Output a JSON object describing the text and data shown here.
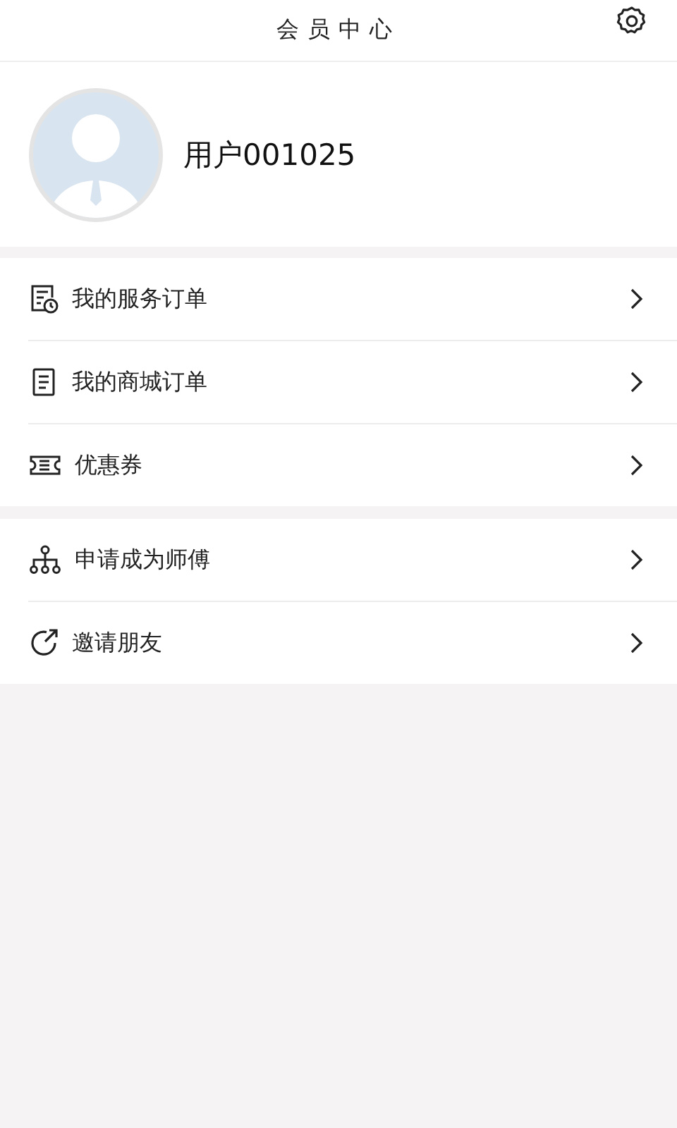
{
  "header": {
    "title": "会员中心"
  },
  "profile": {
    "username": "用户001025"
  },
  "menu_groups": [
    {
      "items": [
        {
          "label": "我的服务订单"
        },
        {
          "label": "我的商城订单"
        },
        {
          "label": "优惠券"
        }
      ]
    },
    {
      "items": [
        {
          "label": "申请成为师傅"
        },
        {
          "label": "邀请朋友"
        }
      ]
    }
  ]
}
